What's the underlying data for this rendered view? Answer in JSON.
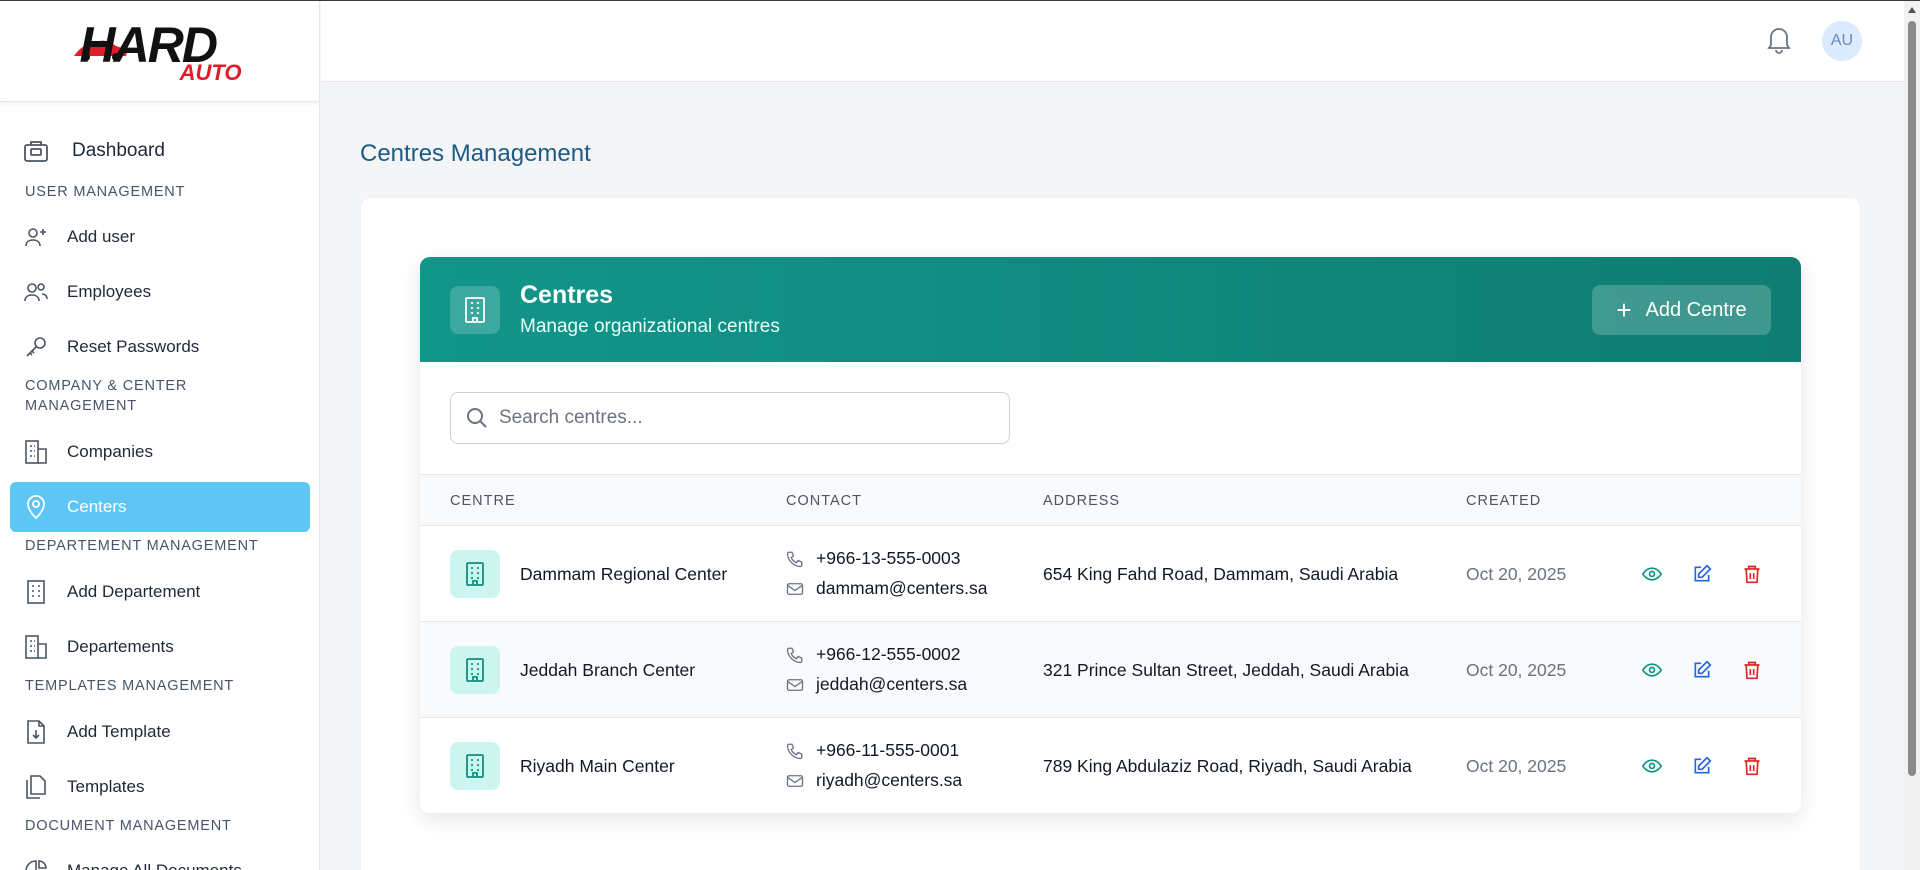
{
  "brand": {
    "logo_main": "HARD",
    "logo_sub": "AUTO"
  },
  "sidebar": {
    "dashboard": "Dashboard",
    "sections": [
      {
        "title": "USER MANAGEMENT"
      },
      {
        "title": "COMPANY & CENTER MANAGEMENT"
      },
      {
        "title": "DEPARTEMENT MANAGEMENT"
      },
      {
        "title": "TEMPLATES MANAGEMENT"
      },
      {
        "title": "DOCUMENT MANAGEMENT"
      }
    ],
    "items": [
      {
        "label": "Add user"
      },
      {
        "label": "Employees"
      },
      {
        "label": "Reset Passwords"
      },
      {
        "label": "Companies"
      },
      {
        "label": "Centers"
      },
      {
        "label": "Add Departement"
      },
      {
        "label": "Departements"
      },
      {
        "label": "Add Template"
      },
      {
        "label": "Templates"
      },
      {
        "label": "Manage All Documents"
      }
    ],
    "active": "Centers"
  },
  "header": {
    "avatar_initials": "AU"
  },
  "page": {
    "title": "Centres Management"
  },
  "panel": {
    "title": "Centres",
    "subtitle": "Manage organizational centres",
    "add_button": "Add Centre",
    "search_placeholder": "Search centres..."
  },
  "table": {
    "columns": [
      "CENTRE",
      "CONTACT",
      "ADDRESS",
      "CREATED"
    ],
    "rows": [
      {
        "name": "Dammam Regional Center",
        "phone": "+966-13-555-0003",
        "email": "dammam@centers.sa",
        "address": "654 King Fahd Road, Dammam, Saudi Arabia",
        "created": "Oct 20, 2025"
      },
      {
        "name": "Jeddah Branch Center",
        "phone": "+966-12-555-0002",
        "email": "jeddah@centers.sa",
        "address": "321 Prince Sultan Street, Jeddah, Saudi Arabia",
        "created": "Oct 20, 2025"
      },
      {
        "name": "Riyadh Main Center",
        "phone": "+966-11-555-0001",
        "email": "riyadh@centers.sa",
        "address": "789 King Abdulaziz Road, Riyadh, Saudi Arabia",
        "created": "Oct 20, 2025"
      }
    ]
  },
  "colors": {
    "accent": "#12968a",
    "active_nav": "#5ec6f5",
    "title": "#1e5a84",
    "delete": "#dc2626",
    "edit": "#2563eb",
    "view": "#0d9488"
  },
  "icons": [
    "bell-icon",
    "building-icon",
    "phone-icon",
    "mail-icon",
    "eye-icon",
    "edit-icon",
    "trash-icon",
    "search-icon",
    "plus-icon"
  ]
}
